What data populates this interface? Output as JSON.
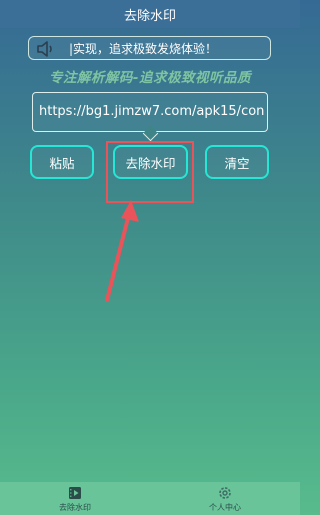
{
  "header": {
    "title": "去除水印"
  },
  "marquee": {
    "text": "|实现，追求极致发烧体验！",
    "icon": "speaker-icon"
  },
  "slogan": "专注解析解码-追求极致视听品质",
  "url_input": {
    "value": "https://bg1.jimzw7.com/apk15/con"
  },
  "buttons": {
    "paste": "粘贴",
    "remove_watermark": "去除水印",
    "clear": "清空"
  },
  "tabbar": {
    "tabs": [
      {
        "label": "去除水印",
        "icon": "video-icon",
        "active": true
      },
      {
        "label": "个人中心",
        "icon": "gear-icon",
        "active": false
      }
    ]
  },
  "colors": {
    "accent": "#26e6d6",
    "annotation": "#e8545a",
    "tabbar": "#6ac49a"
  }
}
